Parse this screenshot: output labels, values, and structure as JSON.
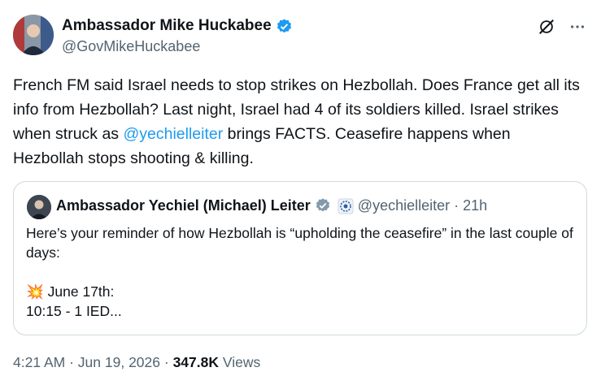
{
  "author": {
    "display_name": "Ambassador Mike Huckabee",
    "handle": "@GovMikeHuckabee"
  },
  "tweet": {
    "text_before_mention": "French FM said Israel needs to stop strikes on Hezbollah. Does France get all its info from Hezbollah? Last night, Israel had 4 of its soldiers killed. Israel strikes when struck as ",
    "mention": "@yechielleiter",
    "text_after_mention": " brings FACTS. Ceasefire happens when Hezbollah stops shooting & killing."
  },
  "quoted_tweet": {
    "display_name": "Ambassador Yechiel (Michael) Leiter",
    "handle": "@yechielleiter",
    "separator": "·",
    "time": "21h",
    "lines": [
      "Here’s your reminder of how Hezbollah is “upholding the ceasefire” in the last couple of days:",
      "",
      "💥 June 17th:",
      "10:15 - 1 IED..."
    ]
  },
  "meta": {
    "time": "4:21 AM",
    "separator": "·",
    "date": "Jun 19, 2026",
    "views_count": "347.8K",
    "views_label": "Views"
  },
  "icons": {
    "verified": "verified-badge-icon",
    "grok": "grok-icon",
    "more": "more-icon",
    "emblem": "emblem-icon"
  },
  "colors": {
    "link": "#1d9bf0",
    "secondary_text": "#536471",
    "border": "#cfd9de",
    "verified_blue": "#1d9bf0",
    "verified_gray": "#829aab"
  }
}
